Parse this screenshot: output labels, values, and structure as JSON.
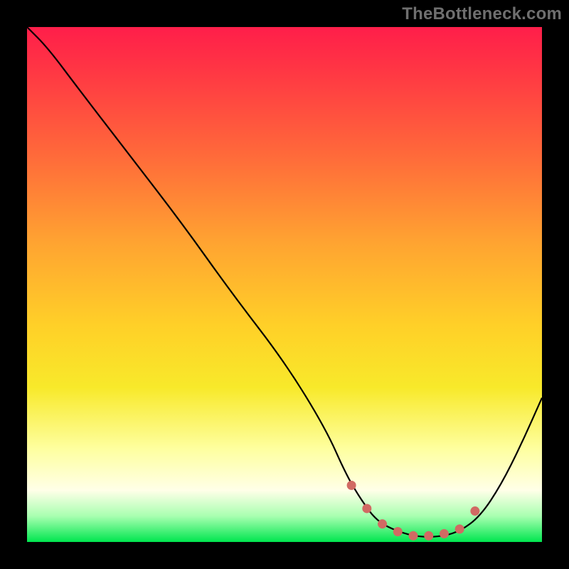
{
  "watermark": "TheBottleneck.com",
  "chart_data": {
    "type": "line",
    "title": "",
    "xlabel": "",
    "ylabel": "",
    "xlim": [
      0,
      100
    ],
    "ylim": [
      0,
      100
    ],
    "grid": false,
    "series": [
      {
        "name": "bottleneck-curve",
        "x": [
          0,
          4,
          10,
          20,
          30,
          40,
          50,
          58,
          62,
          65,
          68,
          72,
          76,
          80,
          84,
          88,
          92,
          96,
          100
        ],
        "values": [
          100,
          96,
          88,
          75,
          62,
          48,
          35,
          22,
          13,
          8,
          4,
          2,
          1,
          1,
          2,
          5,
          11,
          19,
          28
        ]
      }
    ],
    "markers": {
      "name": "optimal-range-dots",
      "color": "#d16a63",
      "x": [
        63,
        66,
        69,
        72,
        75,
        78,
        81,
        84,
        87
      ],
      "values": [
        11,
        6.5,
        3.5,
        2,
        1.2,
        1.2,
        1.6,
        2.5,
        6
      ]
    }
  }
}
